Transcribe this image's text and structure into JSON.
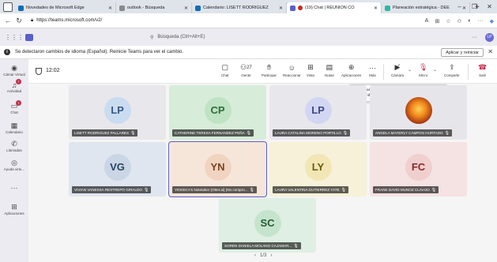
{
  "browser": {
    "tabs": [
      {
        "label": "Novedades de Microsoft Edge",
        "color": "#0f6cbd"
      },
      {
        "label": "outlook - Búsqueda",
        "color": "#8a8a8a"
      },
      {
        "label": "Calendario: LISETT RODRIGUEZ",
        "color": "#0f6cbd"
      },
      {
        "label": "(19) Chat | REUNIÓN CO",
        "color": "#5b5fc7"
      },
      {
        "label": "Planeación estratégica - DEE",
        "color": "#2db7a6"
      }
    ],
    "url": "https://teams.microsoft.com/v2/"
  },
  "teams": {
    "search_placeholder": "Búsqueda (Ctrl+Alt+E)",
    "notice": {
      "text": "Se detectaron cambios de idioma (Español). Reinicie Teams para ver el cambio.",
      "button": "Aplicar y reiniciar"
    },
    "rail": [
      {
        "label": "Cámar Virtual",
        "icon": "camera-icon",
        "glyph": "◉",
        "badge": ""
      },
      {
        "label": "Actividad",
        "icon": "bell-icon",
        "glyph": "♫",
        "badge": "!"
      },
      {
        "label": "Chat",
        "icon": "chat-icon",
        "glyph": "▭",
        "badge": "!"
      },
      {
        "label": "Calendario",
        "icon": "calendar-icon",
        "glyph": "▦",
        "badge": ""
      },
      {
        "label": "Llamadas",
        "icon": "phone-icon",
        "glyph": "✆",
        "badge": ""
      },
      {
        "label": "Ayuda virtu...",
        "icon": "help-icon",
        "glyph": "◎",
        "badge": ""
      },
      {
        "label": "",
        "icon": "more-icon",
        "glyph": "···",
        "badge": ""
      },
      {
        "label": "Aplicaciones",
        "icon": "apps-icon",
        "glyph": "⊞",
        "badge": ""
      }
    ]
  },
  "meeting": {
    "timer": "12:02",
    "participant_count": "27",
    "toolbar": {
      "chat": "Chat",
      "people": "Gente",
      "raise": "Participar",
      "react": "Reaccionar",
      "view": "Vista",
      "notes": "Notas",
      "apps": "Aplicaciones",
      "more": "Más",
      "camera": "Cámara",
      "mic": "Micro",
      "share": "Compartir",
      "leave": "Salir"
    },
    "tooltip": {
      "line1": "Reactivar audio del micrófono",
      "line2": "(Ctrl+Shift+M)"
    },
    "tiles": [
      {
        "initials": "LP",
        "name": "LISETT RODRIGUEZ PALLARES",
        "bg": "#e8e8ec",
        "avatar_bg": "#c9dcf0",
        "fg": "#3b5a80"
      },
      {
        "initials": "CP",
        "name": "CATHERINE TERESA FERNANDEZ PEÑA",
        "bg": "#d7ecd9",
        "avatar_bg": "#bfe3c4",
        "fg": "#2f6b3a"
      },
      {
        "initials": "LP",
        "name": "LAURA CATALINA MORENO PORTILLO",
        "bg": "#e8e8ec",
        "avatar_bg": "#d3d6f2",
        "fg": "#3d4589"
      },
      {
        "initials": "",
        "name": "ANGELA MAYERLY CAMPOS HURTADO",
        "bg": "#e6e6ea",
        "avatar_bg": "",
        "fg": ""
      },
      {
        "initials": "VG",
        "name": "VIVIAN VANESSA RESTREPO GIRALDO",
        "bg": "#e0e6ef",
        "avatar_bg": "#cad6e6",
        "fg": "#2c4561"
      },
      {
        "initials": "YN",
        "name": "YESSICA's Notetaker (Otter.ai) (No compro...",
        "bg": "#f6e6da",
        "avatar_bg": "#f0d4c0",
        "fg": "#7a4322"
      },
      {
        "initials": "LY",
        "name": "LAURA VALENTINA GUTIERREZ YATE",
        "bg": "#f6f1d8",
        "avatar_bg": "#f1e6b4",
        "fg": "#6b5a10"
      },
      {
        "initials": "FC",
        "name": "FRANK DAVID MUNOZ CLAVIJO",
        "bg": "#f5e2e2",
        "avatar_bg": "#f0cfcf",
        "fg": "#8a2a2a"
      },
      {
        "initials": "SC",
        "name": "SOREN DANIELA MOLANO CAJAMAR...",
        "bg": "#dfefe3",
        "avatar_bg": "#c6e4cd",
        "fg": "#245a33"
      }
    ],
    "pager": "1/3"
  }
}
